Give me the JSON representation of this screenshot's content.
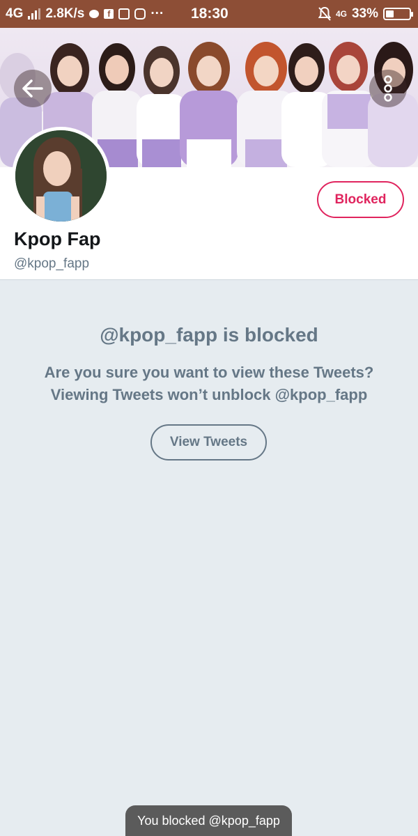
{
  "status_bar": {
    "network": "4G",
    "speed": "2.8K/s",
    "time": "18:30",
    "network_right": "4G",
    "battery_percent": "33%",
    "battery_level": 0.33,
    "more_dots": "···"
  },
  "header": {
    "back_icon": "arrow-left-icon",
    "more_icon": "vertical-dots-icon"
  },
  "profile": {
    "display_name": "Kpop Fap",
    "handle": "@kpop_fapp",
    "blocked_label": "Blocked"
  },
  "blocked_notice": {
    "title": "@kpop_fapp is blocked",
    "line1": "Are you sure you want to view these Tweets?",
    "line2": "Viewing Tweets won’t unblock @kpop_fapp",
    "view_button": "View Tweets"
  },
  "toast": {
    "message": "You blocked @kpop_fapp"
  },
  "colors": {
    "status_bar_bg": "#8d4e36",
    "accent_red": "#e0245e",
    "muted_text": "#657786",
    "page_bg": "#e6ecf0"
  }
}
